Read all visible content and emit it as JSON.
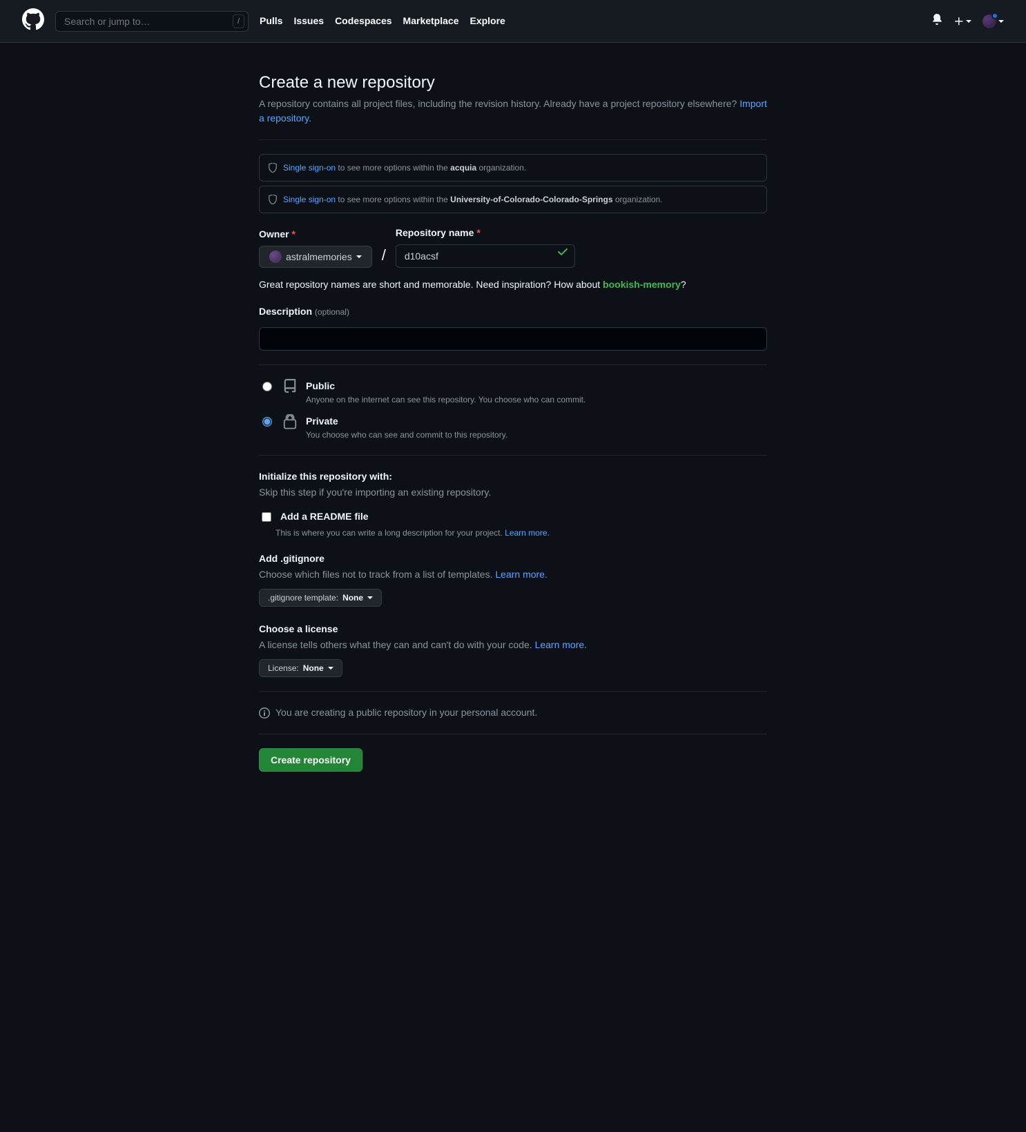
{
  "header": {
    "search_placeholder": "Search or jump to…",
    "kbd": "/",
    "nav": [
      "Pulls",
      "Issues",
      "Codespaces",
      "Marketplace",
      "Explore"
    ]
  },
  "page": {
    "title": "Create a new repository",
    "lead_before": "A repository contains all project files, including the revision history. Already have a project repository elsewhere? ",
    "lead_link": "Import a repository."
  },
  "sso": [
    {
      "link": "Single sign-on",
      "mid": " to see more options within the ",
      "org": "acquia",
      "tail": " organization."
    },
    {
      "link": "Single sign-on",
      "mid": " to see more options within the ",
      "org": "University-of-Colorado-Colorado-Springs",
      "tail": " organization."
    }
  ],
  "owner": {
    "label": "Owner",
    "value": "astralmemories"
  },
  "repo": {
    "label": "Repository name",
    "value": "d10acsf"
  },
  "hint": {
    "before": "Great repository names are short and memorable. Need inspiration? How about ",
    "suggest": "bookish-memory",
    "after": "?"
  },
  "description": {
    "label": "Description",
    "optional": "(optional)",
    "value": ""
  },
  "visibility": {
    "public": {
      "title": "Public",
      "desc": "Anyone on the internet can see this repository. You choose who can commit."
    },
    "private": {
      "title": "Private",
      "desc": "You choose who can see and commit to this repository."
    }
  },
  "init": {
    "heading": "Initialize this repository with:",
    "sub": "Skip this step if you're importing an existing repository.",
    "readme": {
      "label": "Add a README file",
      "desc": "This is where you can write a long description for your project. ",
      "learn": "Learn more."
    },
    "gitignore": {
      "heading": "Add .gitignore",
      "sub": "Choose which files not to track from a list of templates. ",
      "learn": "Learn more.",
      "btn_prefix": ".gitignore template: ",
      "btn_value": "None"
    },
    "license": {
      "heading": "Choose a license",
      "sub": "A license tells others what they can and can't do with your code. ",
      "learn": "Learn more.",
      "btn_prefix": "License: ",
      "btn_value": "None"
    }
  },
  "notice": "You are creating a public repository in your personal account.",
  "submit": "Create repository"
}
